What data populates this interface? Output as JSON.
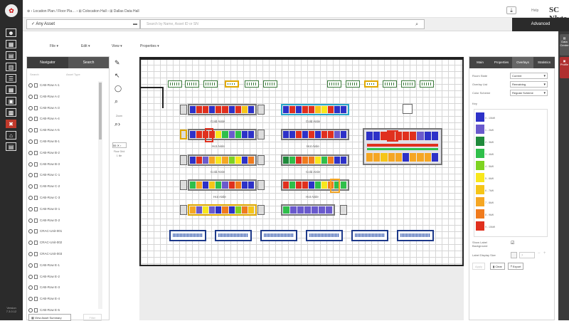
{
  "app": {
    "logo_glyph": "✿",
    "brand": "SC Nlyte",
    "version_text": "Version 7.3.0.12"
  },
  "breadcrumb": "⊕ › Location Plan / Floor Pla… › ⊞ Colocation Hall › ⊞ Dallas Data Hall",
  "help_text": "Help",
  "asset_selector": {
    "value": "Any Asset"
  },
  "search": {
    "placeholder": "Search by Name, Asset ID or SN"
  },
  "advanced_label": "Advanced",
  "left_nav_icons": [
    "users-icon",
    "dashboard-icon",
    "reports-icon",
    "map-icon",
    "list-icon",
    "grid-icon",
    "network-icon",
    "power-icon",
    "alert-icon",
    "home-icon",
    "cabinet-icon"
  ],
  "menu": [
    "File ▾",
    "Edit ▾",
    "View ▾",
    "Properties ▾"
  ],
  "navigator": {
    "tabs": [
      "Navigator",
      "Search"
    ],
    "search_labels": [
      "Search",
      "Asset Type"
    ],
    "items": [
      "CAB-Row A-1",
      "CAB-Row A-2",
      "CAB-Row A-3",
      "CAB-Row A-4",
      "CAB-Row A-5",
      "CAB-Row B-1",
      "CAB-Row B-2",
      "CAB-Row B-3",
      "CAB-Row C-1",
      "CAB-Row C-2",
      "CAB-Row C-3",
      "CAB-Row D-1",
      "CAB-Row D-2",
      "CRAC-Unit-001",
      "CRAC-Unit-002",
      "CRAC-Unit-003",
      "CAB-Row E-1",
      "CAB-Row E-2",
      "CAB-Row E-3",
      "CAB-Row E-4",
      "CAB-Row E-5"
    ],
    "view_summary_label": "View Asset Summary",
    "filter_label": "Filter"
  },
  "tools": {
    "zoom_label": "Zoom",
    "zoom_value": "55",
    "scale_label": "Floor Grid",
    "scale_value": "1 tile"
  },
  "floor": {
    "aisle_labels": [
      "Cold Aisle",
      "Cold Aisle",
      "Hot Aisle",
      "Hot Aisle",
      "Cold Aisle",
      "Cold Aisle",
      "Hot Aisle",
      "Hot Aisle"
    ]
  },
  "right_panel": {
    "tabs": [
      "Main",
      "Properties",
      "Overlays",
      "Statistics"
    ],
    "active_tab": "Overlays",
    "fields": [
      {
        "label": "Room State",
        "value": "Current"
      },
      {
        "label": "Overlay List",
        "value": "Remaining"
      },
      {
        "label": "Color Scheme",
        "value": "Regular Scheme"
      }
    ],
    "key_label": "Key",
    "key": [
      {
        "color": "#2d31c8",
        "label": "0 - 10kW"
      },
      {
        "color": "#6a5acd",
        "label": "1 - 2kW"
      },
      {
        "color": "#1f8a3b",
        "label": "2 - 3kW"
      },
      {
        "color": "#2fbf4a",
        "label": "3 - 4kW"
      },
      {
        "color": "#7ed321",
        "label": "4 - 5kW"
      },
      {
        "color": "#f8e71c",
        "label": "5 - 6kW"
      },
      {
        "color": "#f5c518",
        "label": "6 - 7kW"
      },
      {
        "color": "#f5a623",
        "label": "7 - 8kW"
      },
      {
        "color": "#f07b1d",
        "label": "8 - 9kW"
      },
      {
        "color": "#e0301e",
        "label": "9 - 10kW"
      }
    ],
    "show_label_bg": "Show Label Background",
    "label_display": "Label Display Size",
    "label_size_value": "7",
    "buttons": [
      "Apply",
      "Clear",
      "Export"
    ]
  },
  "right_dock": [
    "Data Centre",
    "Profile"
  ]
}
